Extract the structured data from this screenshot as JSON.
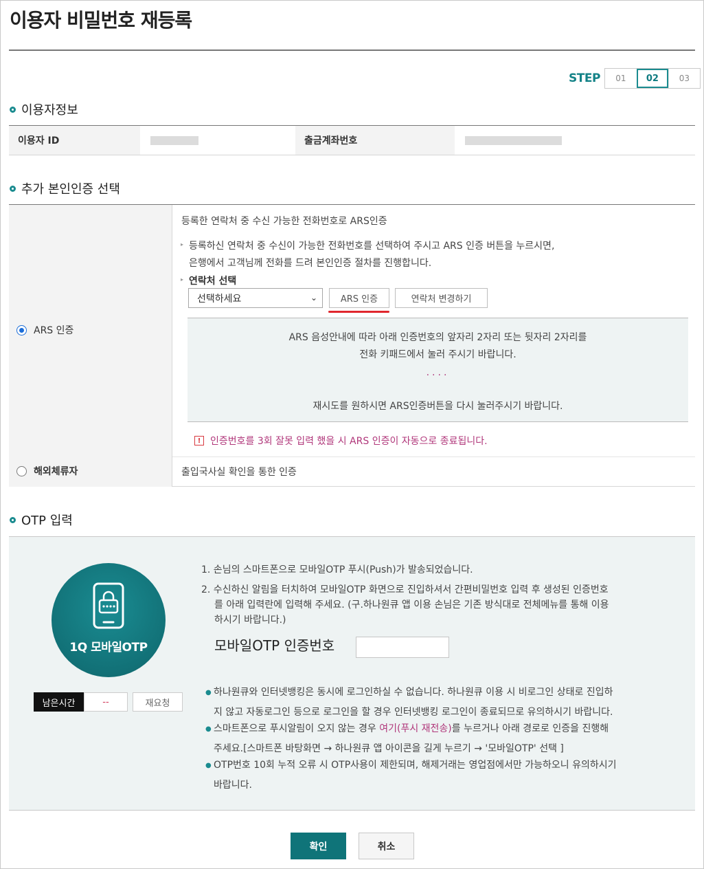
{
  "page": {
    "title": "이용자 비밀번호 재등록"
  },
  "step": {
    "label": "STEP",
    "items": [
      "01",
      "02",
      "03"
    ],
    "active": "02"
  },
  "user_info": {
    "section_title": "이용자정보",
    "id_label": "이용자 ID",
    "account_label": "출금계좌번호"
  },
  "auth": {
    "section_title": "추가 본인인증 선택",
    "ars_radio_label": "ARS 인증",
    "ars_desc": "등록한 연락처 중 수신 가능한 전화번호로 ARS인증",
    "ars_help_1": "등록하신 연락처 중 수신이 가능한 전화번호를 선택하여 주시고 ARS 인증 버튼을 누르시면,",
    "ars_help_2": "은행에서 고객님께 전화를 드려 본인인증 절차를 진행합니다.",
    "contact_label": "연락처 선택",
    "select_placeholder": "선택하세요",
    "ars_button": "ARS 인증",
    "change_contact_button": "연락처 변경하기",
    "box_line_1": "ARS 음성안내에 따라 아래 인증번호의 앞자리 2자리 또는 뒷자리 2자리를",
    "box_line_2": "전화 키패드에서 눌러 주시기 바랍니다.",
    "box_dots": "····",
    "box_line_3": "재시도를 원하시면 ARS인증버튼을 다시 눌러주시기 바랍니다.",
    "warning": "인증번호를 3회 잘못 입력 했을 시 ARS 인증이 자동으로 종료됩니다.",
    "overseas_radio_label": "해외체류자",
    "overseas_desc": "출입국사실 확인을 통한 인증"
  },
  "otp": {
    "section_title": "OTP 입력",
    "circle_label": "1Q 모바일OTP",
    "timer_label": "남은시간",
    "timer_value": "--",
    "resend_button": "재요청",
    "step_1": "1. 손님의 스마트폰으로 모바일OTP 푸시(Push)가 발송되었습니다.",
    "step_2a": "2. 수신하신 알림을 터치하여 모바일OTP 화면으로 진입하셔서 간편비밀번호 입력 후 생성된 인증번호",
    "step_2b": "를 아래 입력란에 입력해 주세요. (구.하나원큐 앱 이용 손님은 기존 방식대로 전체메뉴를 통해 이용",
    "step_2c": "하시기 바랍니다.)",
    "input_label": "모바일OTP 인증번호",
    "note_1a": "하나원큐와 인터넷뱅킹은 동시에 로그인하실 수 없습니다. 하나원큐 이용 시 비로그인 상태로 진입하",
    "note_1b": "지 않고 자동로그인 등으로 로그인을 할 경우 인터넷뱅킹 로그인이 종료되므로 유의하시기 바랍니다.",
    "note_2a_pre": "스마트폰으로 푸시알림이 오지 않는 경우 ",
    "note_2a_link": "여기(푸시 재전송)",
    "note_2a_post": "를 누르거나 아래 경로로 인증을 진행해",
    "note_2b": "주세요.[스마트폰 바탕화면 → 하나원큐 앱 아이콘을 길게 누르기 → '모바일OTP' 선택 ]",
    "note_3a": "OTP번호 10회 누적 오류 시 OTP사용이 제한되며, 해제거래는 영업점에서만 가능하오니 유의하시기",
    "note_3b": "바랍니다."
  },
  "actions": {
    "confirm": "확인",
    "cancel": "취소"
  },
  "colors": {
    "accent": "#0f7479",
    "warning": "#b0367a",
    "radio": "#1b6dd8"
  }
}
